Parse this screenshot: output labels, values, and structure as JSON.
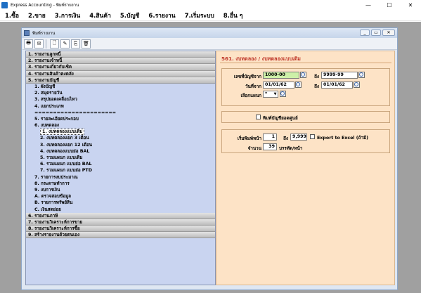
{
  "window": {
    "title": "Express Accounting - พิมพ์รายงาน",
    "controls": {
      "minimize": "—",
      "maximize": "☐",
      "close": "✕"
    }
  },
  "menu": [
    "1.ซื้อ",
    "2.ขาย",
    "3.การเงิน",
    "4.สินค้า",
    "5.บัญชี",
    "6.รายงาน",
    "7.เริ่มระบบ",
    "8.อื่น ๆ"
  ],
  "child_window": {
    "title": "พิมพ์รายงาน",
    "controls": {
      "minimize": "_",
      "restore": "▭",
      "close": "✕"
    }
  },
  "toolbar": {
    "icons": [
      "printer-icon",
      "mail-icon",
      "new-document-icon",
      "edit-document-icon",
      "copy-document-icon",
      "trash-icon"
    ],
    "glyphs": [
      "🖶",
      "✉",
      "🗋",
      "✎",
      "⎘",
      "🗑"
    ]
  },
  "tree": [
    {
      "label": "1. รายงานลูกหนี้",
      "type": "header"
    },
    {
      "label": "2. รายงานเจ้าหนี้",
      "type": "header"
    },
    {
      "label": "3. รายงานเกี่ยวกับเช็ค",
      "type": "header"
    },
    {
      "label": "4. รายงานสินค้าคงคลัง",
      "type": "header"
    },
    {
      "label": "5. รายงานบัญชี",
      "type": "header"
    },
    {
      "label": "1. ผังบัญชี",
      "type": "l1"
    },
    {
      "label": "2. สมุดรายวัน",
      "type": "l1"
    },
    {
      "label": "3. สรุปยอดเคลื่อนไหว",
      "type": "l1"
    },
    {
      "label": "4. แยกประเภท",
      "type": "l1"
    },
    {
      "label": "======================",
      "type": "l1"
    },
    {
      "label": "5. รายละเอียดประกอบ",
      "type": "l1"
    },
    {
      "label": "6. งบทดลอง",
      "type": "l1"
    },
    {
      "label": "1. งบทดลองแบบเดิม",
      "type": "l2",
      "selected": true
    },
    {
      "label": "2. งบทดลองแยก 3 เดือน",
      "type": "l2"
    },
    {
      "label": "3. งบทดลองแยก 12 เดือน",
      "type": "l2"
    },
    {
      "label": "4. งบทดลองแบบย่อ BAL",
      "type": "l2"
    },
    {
      "label": "5. รวมแผนก แบบเดิม",
      "type": "l2"
    },
    {
      "label": "6. รวมแผนก แบบย่อ BAL",
      "type": "l2"
    },
    {
      "label": "7. รวมแผนก แบบย่อ PTD",
      "type": "l2"
    },
    {
      "label": "7. รายการงบประมาณ",
      "type": "l1"
    },
    {
      "label": "8. กระดาษทำการ",
      "type": "l1"
    },
    {
      "label": "9. งบการเงิน",
      "type": "l1"
    },
    {
      "label": "A. ตรวจสอบข้อมูล",
      "type": "l1"
    },
    {
      "label": "B. รายการทรัพย์สิน",
      "type": "l1"
    },
    {
      "label": "C. เงินสดย่อย",
      "type": "l1"
    },
    {
      "label": "6. รายงานภาษี",
      "type": "header"
    },
    {
      "label": "7. รายงานวิเคราะห์การขาย",
      "type": "header"
    },
    {
      "label": "8. รายงานวิเคราะห์การซื้อ",
      "type": "header"
    },
    {
      "label": "9. สร้างรายงานด้วยตนเอง",
      "type": "header"
    }
  ],
  "form": {
    "title": "561. งบทดลอง / งบทดลองแบบเดิม",
    "account_from_label": "เลขที่บัญชีจาก",
    "account_from": "1000-00",
    "account_to_label": "ถึง",
    "account_to": "9999-99",
    "date_from_label": "วันที่จาก",
    "date_from": "01/01/62",
    "date_to_label": "ถึง",
    "date_to": "01/01/62",
    "dept_label": "เลือกแผนก",
    "dept_value": "*",
    "print_zero_label": "พิมพ์บัญชียอดศูนย์",
    "page_from_label": "เริ่มพิมพ์หน้า",
    "page_from": "1",
    "page_to_label": "ถึง",
    "page_to": "9,999",
    "export_label": "Export to Excel (ถ้ามี)",
    "lines_label": "จำนวน",
    "lines_value": "39",
    "lines_unit": "บรรทัด/หน้า"
  }
}
